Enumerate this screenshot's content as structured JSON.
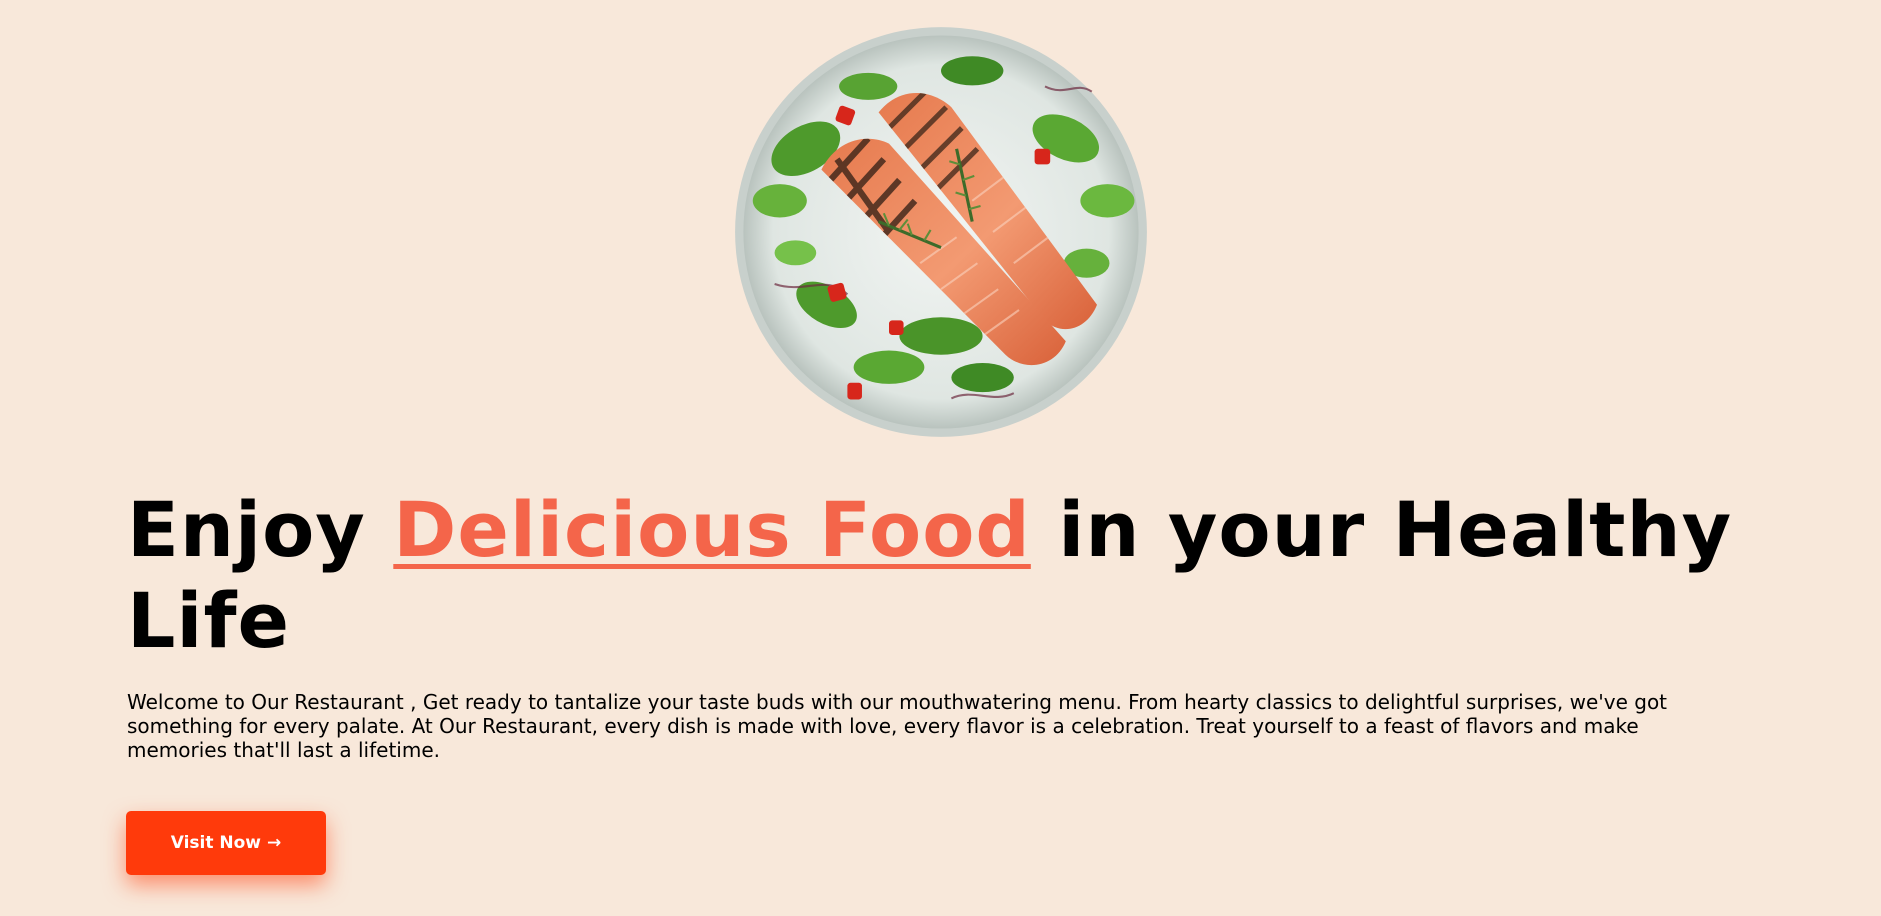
{
  "hero": {
    "image_name": "grilled-salmon-salad-plate",
    "headline": {
      "prefix": "Enjoy ",
      "highlight": "Delicious Food",
      "suffix": " in your Healthy Life"
    },
    "intro": "Welcome to Our Restaurant , Get ready to tantalize your taste buds with our mouthwatering menu. From hearty classics to delightful surprises, we've got something for every palate. At Our Restaurant, every dish is made with love, every flavor is a celebration. Treat yourself to a feast of flavors and make memories that'll last a lifetime.",
    "cta": {
      "label": "Visit Now",
      "icon": "arrow-right-icon",
      "arrow": "→"
    }
  },
  "colors": {
    "background": "#f8e8da",
    "accent": "#f4654a",
    "button": "#ff3a0b",
    "button_text": "#ffffff",
    "text": "#000000"
  }
}
